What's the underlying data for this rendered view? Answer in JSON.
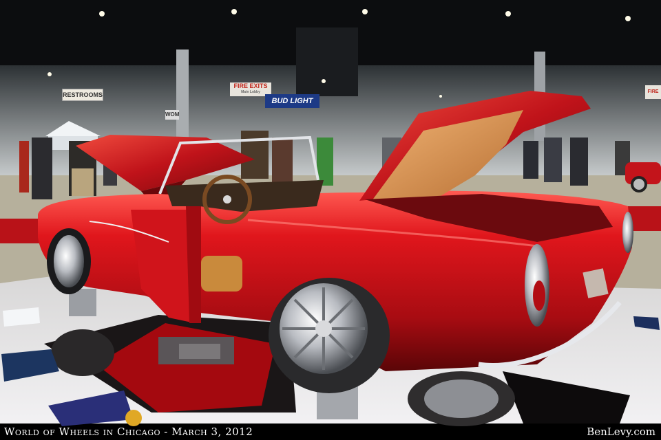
{
  "photo": {
    "signs": {
      "restrooms": "RESTROOMS",
      "fire_exits": "FIRE EXITS",
      "fire_exits_sub": "Main Lobby",
      "bud_light": "BUD LIGHT",
      "wom": "WOM",
      "fire_right": "FIRE"
    },
    "colors": {
      "car_red": "#c8151c",
      "interior_tan": "#c98a3c",
      "floor": "#e9e7ea",
      "carpet_red": "#c0141b"
    }
  },
  "caption": {
    "left": "World of Wheels in Chicago - March 3, 2012",
    "right": "BenLevy.com"
  }
}
